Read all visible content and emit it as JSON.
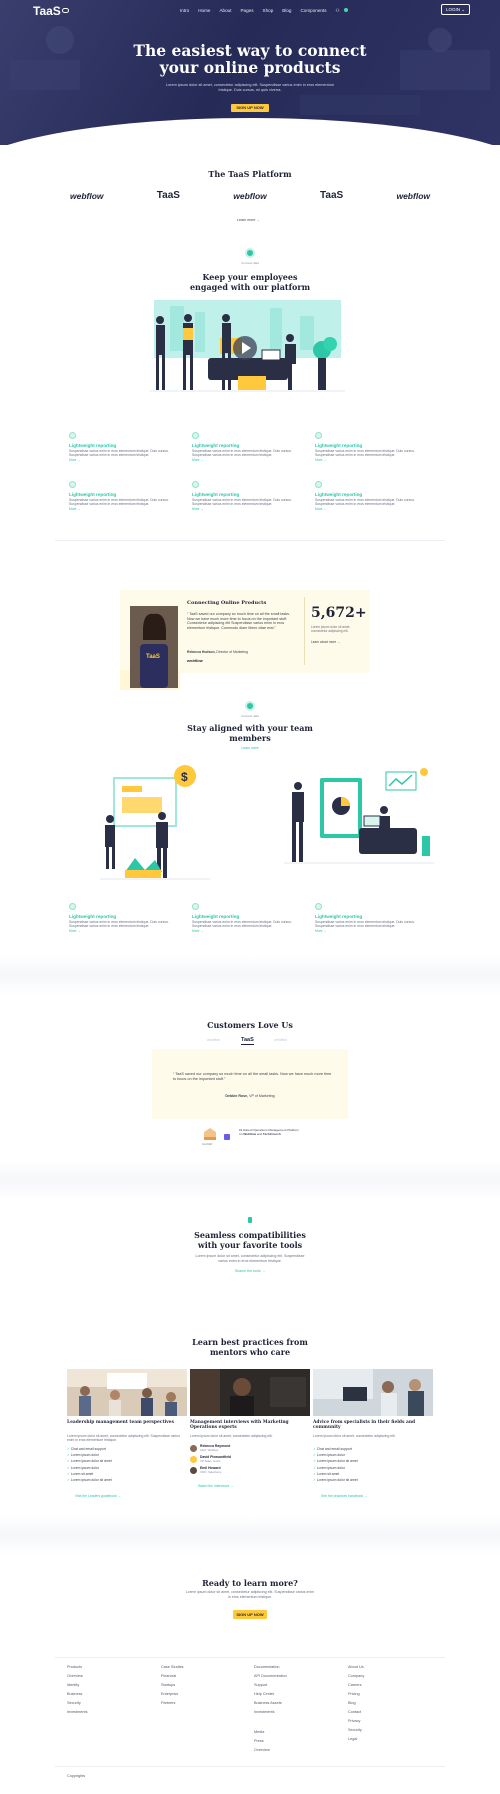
{
  "nav": {
    "brand": "TaaS",
    "links": [
      "Intro",
      "Home",
      "About",
      "Pages",
      "Shop",
      "Blog",
      "Components"
    ],
    "login": "LOGIN"
  },
  "hero": {
    "title_line1": "The easiest way to connect",
    "title_line2": "your online products",
    "text": "Lorem ipsum dolor sit amet, consectetur adipiscing elit. Suspendisse varius enim in eros elementum tristique. Duis cursus, mi quis viverra.",
    "cta": "SIGN UP NOW"
  },
  "platform": {
    "title": "The TaaS Platform",
    "logos": [
      "webflow",
      "TaaS",
      "webflow",
      "TaaS",
      "webflow"
    ],
    "more": "Learn more"
  },
  "engaged": {
    "badge": "Connect data",
    "title_line1": "Keep your employees",
    "title_line2": "engaged with our platform",
    "features": [
      {
        "title": "Lightweight reporting",
        "text": "Suspendisse varius enim in eros elementum tristique. Duis cursus. Suspendisse varius enim in eros elementum tristique.",
        "more": "More"
      },
      {
        "title": "Lightweight reporting",
        "text": "Suspendisse varius enim in eros elementum tristique. Duis cursus. Suspendisse varius enim in eros elementum tristique.",
        "more": "More"
      },
      {
        "title": "Lightweight reporting",
        "text": "Suspendisse varius enim in eros elementum tristique. Duis cursus. Suspendisse varius enim in eros elementum tristique.",
        "more": "More"
      },
      {
        "title": "Lightweight reporting",
        "text": "Suspendisse varius enim in eros elementum tristique. Duis cursus. Suspendisse varius enim in eros elementum tristique.",
        "more": "More"
      },
      {
        "title": "Lightweight reporting",
        "text": "Suspendisse varius enim in eros elementum tristique. Duis cursus. Suspendisse varius enim in eros elementum tristique.",
        "more": "More"
      },
      {
        "title": "Lightweight reporting",
        "text": "Suspendisse varius enim in eros elementum tristique. Duis cursus. Suspendisse varius enim in eros elementum tristique.",
        "more": "More"
      }
    ]
  },
  "testimonial": {
    "title": "Connecting Online Products",
    "quote": "“ TaaS saved our company so much time on all the small tasks. Now we have much more time to focus on the important stuff. Consectetur adipiscing elit Suspendisse varius enim in eros elementum tristique. Commodo diam libero vitae erat.”",
    "author": "Rebecca Hudson,",
    "role": "Director of Marketing",
    "company": "webflow",
    "stat_value": "5,672+",
    "stat_text": "Lorem ipsum dolor sit amet, consectetur adipiscing elit.",
    "stat_link": "Learn about more"
  },
  "aligned": {
    "badge": "Connect data",
    "title_line1": "Stay aligned with your team",
    "title_line2": "members",
    "link": "Learn more",
    "features": [
      {
        "title": "Lightweight reporting",
        "text": "Suspendisse varius enim in eros elementum tristique. Duis cursus. Suspendisse varius enim in eros elementum tristique.",
        "more": "More"
      },
      {
        "title": "Lightweight reporting",
        "text": "Suspendisse varius enim in eros elementum tristique. Duis cursus. Suspendisse varius enim in eros elementum tristique.",
        "more": "More"
      },
      {
        "title": "Lightweight reporting",
        "text": "Suspendisse varius enim in eros elementum tristique. Duis cursus. Suspendisse varius enim in eros elementum tristique.",
        "more": "More"
      }
    ]
  },
  "customers": {
    "title": "Customers Love Us",
    "tabs": [
      "webflow",
      "TaaS",
      "webflow"
    ],
    "quote": "“ TaaS saved our company so much time on all the small tasks. Now we have much more time to focus on the important stuff.”",
    "author": "Debbie Rose,",
    "role": "VP of Marketing",
    "award_text": "#1 Rated Operations Management Platform on",
    "award_brand1": "Webflow",
    "award_and": "and",
    "award_brand2": "TechCrunch",
    "award_badge": "LEADER"
  },
  "tools": {
    "title_line1": "Seamless compatibilities",
    "title_line2": "with your favorite tools",
    "text": "Lorem ipsum dolor sit amet, consectetur adipiscing elit. Suspendisse varius enim in eros elementum tristique.",
    "link": "Search the tools"
  },
  "mentors": {
    "title_line1": "Learn best practices from",
    "title_line2": "mentors who care",
    "cards": [
      {
        "title": "Leadership management team perspectives",
        "text": "Lorem ipsum dolor sit amet, consectetur adipiscing elit. Suspendisse varius enim in eros elementum tristique.",
        "bullets": [
          "Chat and email support",
          "Lorem ipsum dolor",
          "Lorem ipsum dolor sit amet",
          "Lorem ipsum dolor",
          "Lorem sit amet",
          "Lorem ipsum dolor sit amet"
        ],
        "link": "Visit the Leaders guidebook"
      },
      {
        "title": "Management interviews with Marketing Operations experts",
        "text": "Lorem ipsum dolor sit amet, consectetur adipiscing elit.",
        "people": [
          {
            "name": "Rebecca Raymond",
            "role": "CEO, Webflow"
          },
          {
            "name": "David Pleasantfield",
            "role": "VP Sales, Gusto"
          },
          {
            "name": "Emil Howard",
            "role": "CMO, Salesforce"
          }
        ],
        "link": "Watch the interviews"
      },
      {
        "title": "Advice from specialists in their fields and community",
        "text": "Lorem ipsum dolor sit amet, consectetur adipiscing elit.",
        "bullets": [
          "Chat and email support",
          "Lorem ipsum dolor",
          "Lorem ipsum dolor sit amet",
          "Lorem ipsum dolor",
          "Lorem sit amet",
          "Lorem ipsum dolor sit amet"
        ],
        "link": "See the practices handbook"
      }
    ]
  },
  "cta": {
    "title": "Ready to learn more?",
    "text": "Lorem ipsum dolor sit amet, consectetur adipiscing elit. Suspendisse varius enim in eros elementum tristique.",
    "button": "SIGN UP NOW"
  },
  "footer": {
    "col1": [
      "Products",
      "Overview",
      "Identity",
      "Business",
      "Security",
      "Investments"
    ],
    "col2": [
      "Case Studies",
      "Financial",
      "Startups",
      "Enterprise",
      "Partners"
    ],
    "col3": [
      "Documentation",
      "API Documentation",
      "Support",
      "Help Center",
      "Business Assets",
      "Investments",
      "Media",
      "Press",
      "Overview"
    ],
    "col4": [
      "About Us",
      "Company",
      "Careers",
      "Pricing",
      "Blog",
      "Contact",
      "Privacy",
      "Security",
      "Legal"
    ],
    "copyright": "Copyrights"
  }
}
